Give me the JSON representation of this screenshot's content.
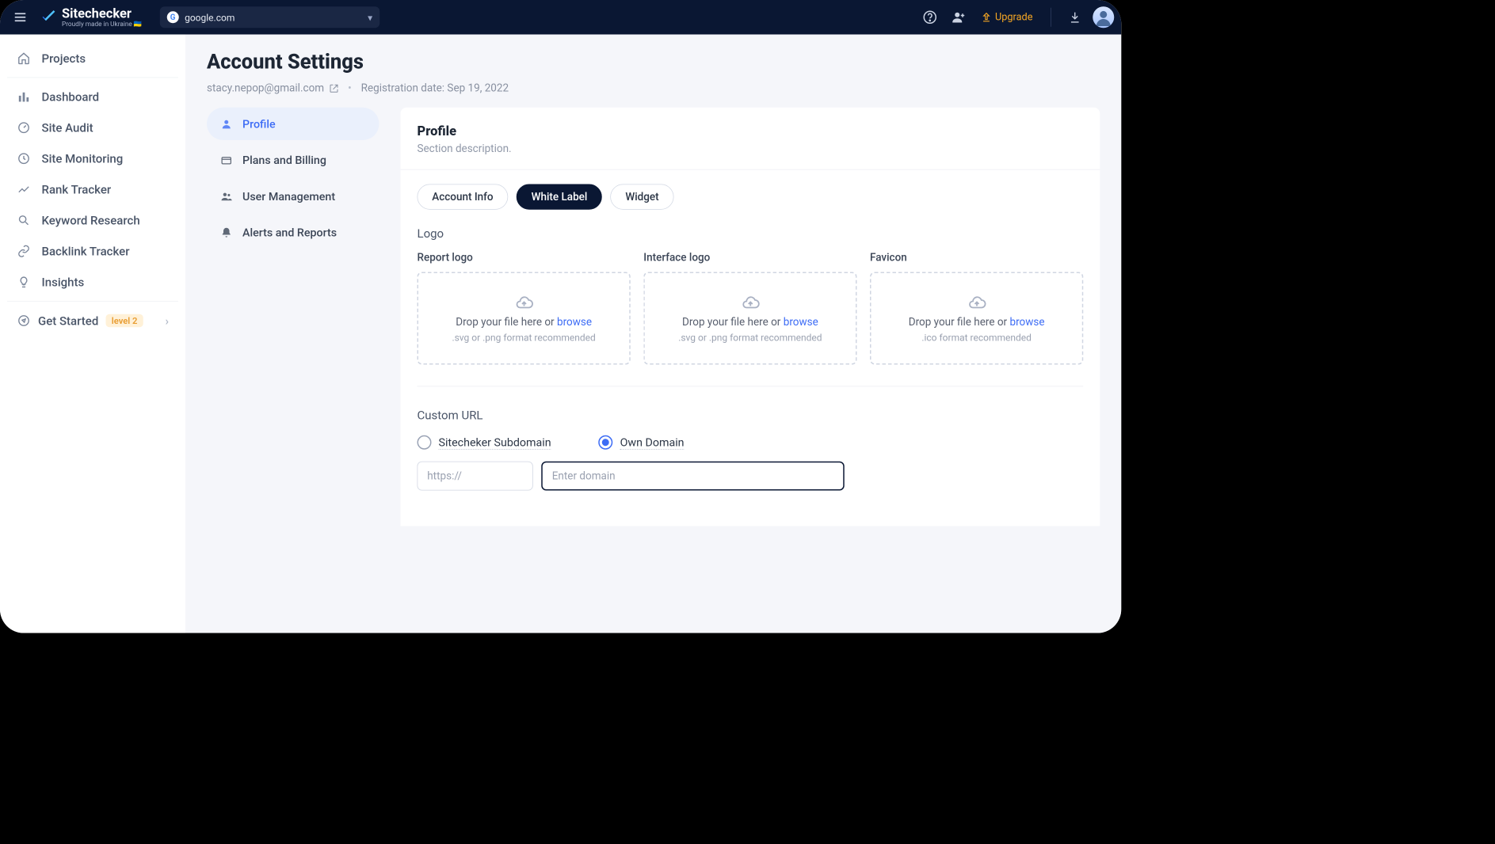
{
  "brand": {
    "name": "Sitechecker",
    "tagline": "Proudly made in Ukraine 🇺🇦"
  },
  "topbar": {
    "site_selector": "google.com",
    "upgrade_label": "Upgrade"
  },
  "sidebar": {
    "projects": "Projects",
    "items": [
      {
        "label": "Dashboard",
        "icon": "dashboard-icon"
      },
      {
        "label": "Site Audit",
        "icon": "gauge-icon"
      },
      {
        "label": "Site Monitoring",
        "icon": "monitor-icon"
      },
      {
        "label": "Rank Tracker",
        "icon": "trend-icon"
      },
      {
        "label": "Keyword Research",
        "icon": "search-icon"
      },
      {
        "label": "Backlink Tracker",
        "icon": "link-icon"
      },
      {
        "label": "Insights",
        "icon": "lightbulb-icon"
      }
    ],
    "get_started": "Get Started",
    "level_badge": "level 2"
  },
  "page": {
    "title": "Account Settings",
    "email": "stacy.nepop@gmail.com",
    "registration_prefix": "Registration date: ",
    "registration_date": "Sep 19, 2022"
  },
  "section_nav": [
    {
      "label": "Profile",
      "active": true
    },
    {
      "label": "Plans and Billing",
      "active": false
    },
    {
      "label": "User Management",
      "active": false
    },
    {
      "label": "Alerts and Reports",
      "active": false
    }
  ],
  "panel": {
    "title": "Profile",
    "description": "Section description.",
    "tabs": [
      {
        "label": "Account Info",
        "active": false
      },
      {
        "label": "White Label",
        "active": true
      },
      {
        "label": "Widget",
        "active": false
      }
    ],
    "logo_section_label": "Logo",
    "uploads": [
      {
        "label": "Report logo",
        "drop_text": "Drop your file here or ",
        "browse": "browse",
        "hint": ".svg or .png format recommended"
      },
      {
        "label": "Interface logo",
        "drop_text": "Drop your file here or ",
        "browse": "browse",
        "hint": ".svg or .png format recommended"
      },
      {
        "label": "Favicon",
        "drop_text": "Drop your file here or ",
        "browse": "browse",
        "hint": ".ico format recommended"
      }
    ],
    "custom_url_label": "Custom URL",
    "radio_options": [
      {
        "label": "Sitecheker Subdomain",
        "checked": false
      },
      {
        "label": "Own Domain",
        "checked": true
      }
    ],
    "protocol_placeholder": "https://",
    "domain_placeholder": "Enter domain"
  }
}
